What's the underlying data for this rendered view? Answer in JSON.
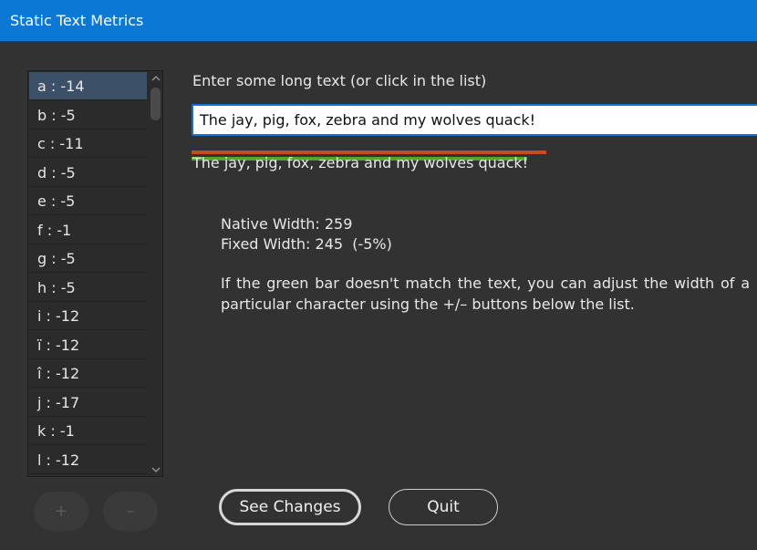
{
  "window": {
    "title": "Static Text Metrics"
  },
  "char_list": {
    "items": [
      {
        "label": "a : -14",
        "selected": true
      },
      {
        "label": "b : -5"
      },
      {
        "label": "c : -11"
      },
      {
        "label": "d : -5"
      },
      {
        "label": "e : -5"
      },
      {
        "label": "f : -1"
      },
      {
        "label": "g : -5"
      },
      {
        "label": "h : -5"
      },
      {
        "label": "i : -12"
      },
      {
        "label": "ï : -12"
      },
      {
        "label": "î : -12"
      },
      {
        "label": "j : -17"
      },
      {
        "label": "k : -1"
      },
      {
        "label": "l : -12"
      }
    ],
    "plus_label": "+",
    "minus_label": "–"
  },
  "main": {
    "prompt": "Enter some long text (or click in the list)",
    "input_value": "The jay, pig, fox, zebra and my wolves quack!",
    "preview_text": "The jay, pig, fox, zebra and my wolves quack!",
    "native_width": "Native Width: 259",
    "fixed_width": "Fixed Width: 245  (-5%)",
    "help_text": "If the green bar doesn't match the text, you can adjust the width of a particular character using the +/– buttons below the list."
  },
  "buttons": {
    "see_changes": "See Changes",
    "quit": "Quit"
  },
  "colors": {
    "titlebar": "#0a78d4",
    "background": "#323232",
    "red_bar": "#c94a1b",
    "green_bar": "#5aa032",
    "selected": "#3c5068"
  }
}
